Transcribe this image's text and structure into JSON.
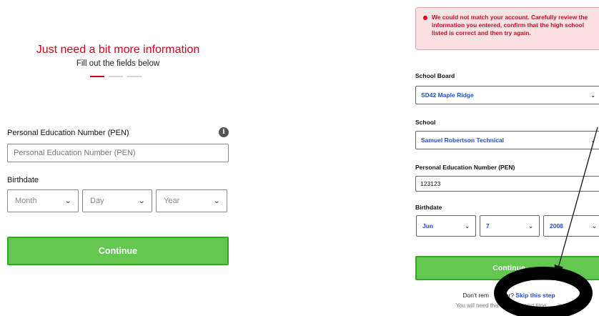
{
  "left": {
    "heading": "Just need a bit more information",
    "subheading": "Fill out the fields below",
    "pen_label": "Personal Education Number (PEN)",
    "pen_placeholder": "Personal Education Number (PEN)",
    "info_glyph": "i",
    "birthdate_label": "Birthdate",
    "month_placeholder": "Month",
    "day_placeholder": "Day",
    "year_placeholder": "Year",
    "continue_label": "Continue",
    "progress_steps": 3,
    "progress_active_step": 1
  },
  "right": {
    "error_message": "We could not match your account. Carefully review the information you entered, confirm that the high school listed is correct and then try again.",
    "school_board_label": "School Board",
    "school_board_value": "SD42 Maple Ridge",
    "school_label": "School",
    "school_value": "Samuel Robertson Technical",
    "pen_label": "Personal Education Number (PEN)",
    "pen_value": "123123",
    "birthdate_label": "Birthdate",
    "month_value": "Jun",
    "day_value": "7",
    "year_value": "2008",
    "continue_label": "Continue",
    "dont_remember_text": "Don't rem",
    "dont_remember_text_2": "ber? ",
    "skip_link": "Skip this step",
    "you_need_text": "You will need this in",
    "you_need_text_2": "ion next time",
    "you_need_text_3": "in"
  },
  "colors": {
    "brand_red": "#d9001b",
    "button_green": "#62c84f",
    "button_border": "#2fa91f",
    "link_blue": "#1f4fd1",
    "error_bg": "#fbe1e2"
  },
  "icons": [
    "info-icon",
    "chevron-down-icon",
    "error-dot-icon",
    "annotation-arrow",
    "annotation-circle"
  ]
}
